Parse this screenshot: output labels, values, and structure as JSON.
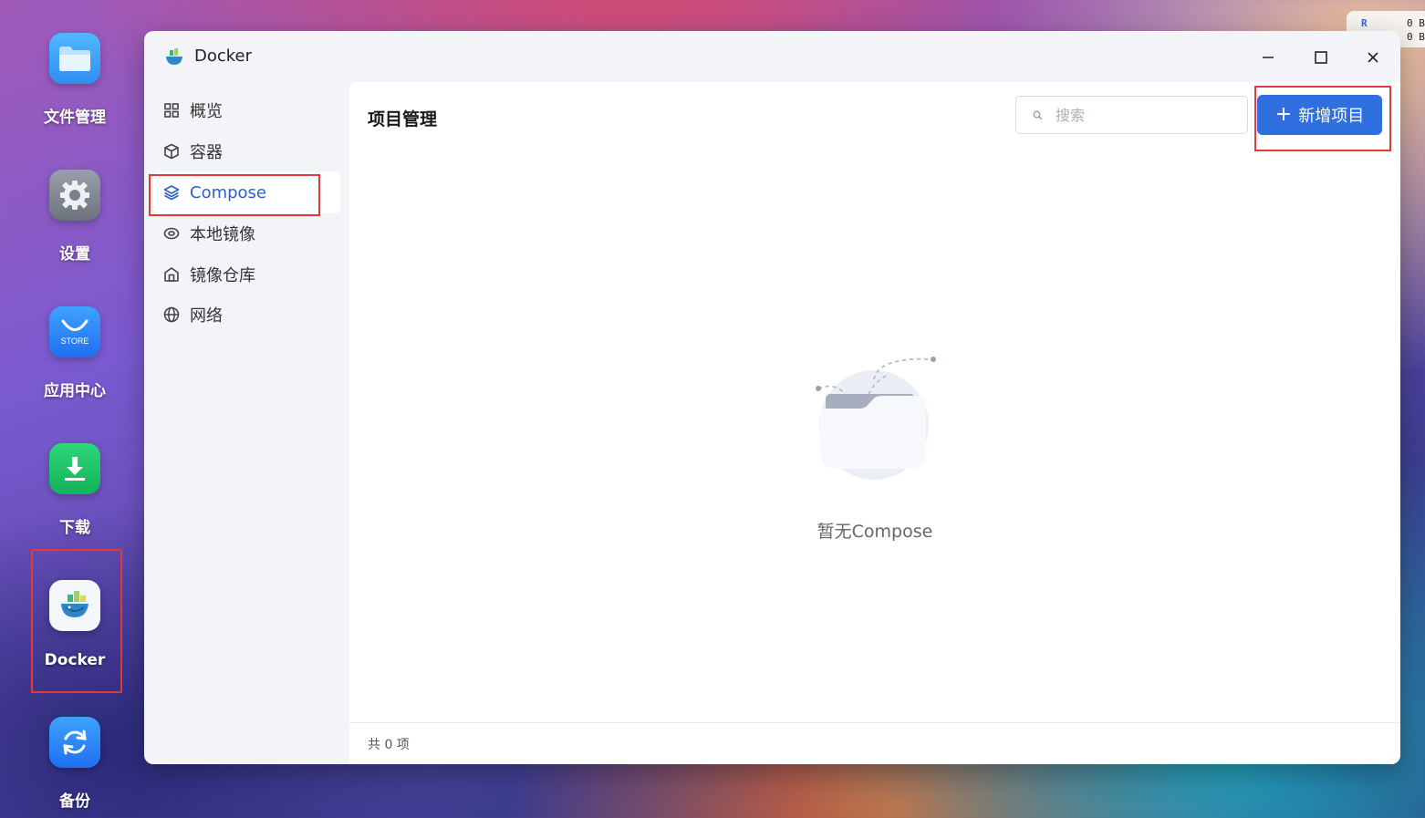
{
  "desktop": {
    "icons": [
      {
        "label": "文件管理",
        "icon": "folder-icon"
      },
      {
        "label": "设置",
        "icon": "gear-icon"
      },
      {
        "label": "应用中心",
        "icon": "store-icon",
        "badge": "STORE"
      },
      {
        "label": "下载",
        "icon": "download-icon"
      },
      {
        "label": "Docker",
        "icon": "docker-icon"
      },
      {
        "label": "备份",
        "icon": "backup-icon"
      }
    ]
  },
  "widget": {
    "r": "R",
    "line1": "0 B",
    "line2": "0 B"
  },
  "window": {
    "title": "Docker",
    "controls": {
      "minimize": "minimize-icon",
      "maximize": "maximize-icon",
      "close": "close-icon"
    }
  },
  "sidebar": {
    "items": [
      {
        "label": "概览",
        "icon": "grid-icon"
      },
      {
        "label": "容器",
        "icon": "box-icon"
      },
      {
        "label": "Compose",
        "icon": "layers-icon",
        "active": true
      },
      {
        "label": "本地镜像",
        "icon": "disc-icon"
      },
      {
        "label": "镜像仓库",
        "icon": "warehouse-icon"
      },
      {
        "label": "网络",
        "icon": "globe-icon"
      }
    ]
  },
  "main": {
    "title": "项目管理",
    "search": {
      "placeholder": "搜索",
      "value": ""
    },
    "add_button": {
      "plus": "+",
      "label": "新增项目"
    },
    "empty_text": "暂无Compose",
    "footer_text": "共 0 项"
  },
  "colors": {
    "accent": "#2f6fe0",
    "active_nav_text": "#2d5fc8",
    "highlight_box": "#e03a3a"
  }
}
